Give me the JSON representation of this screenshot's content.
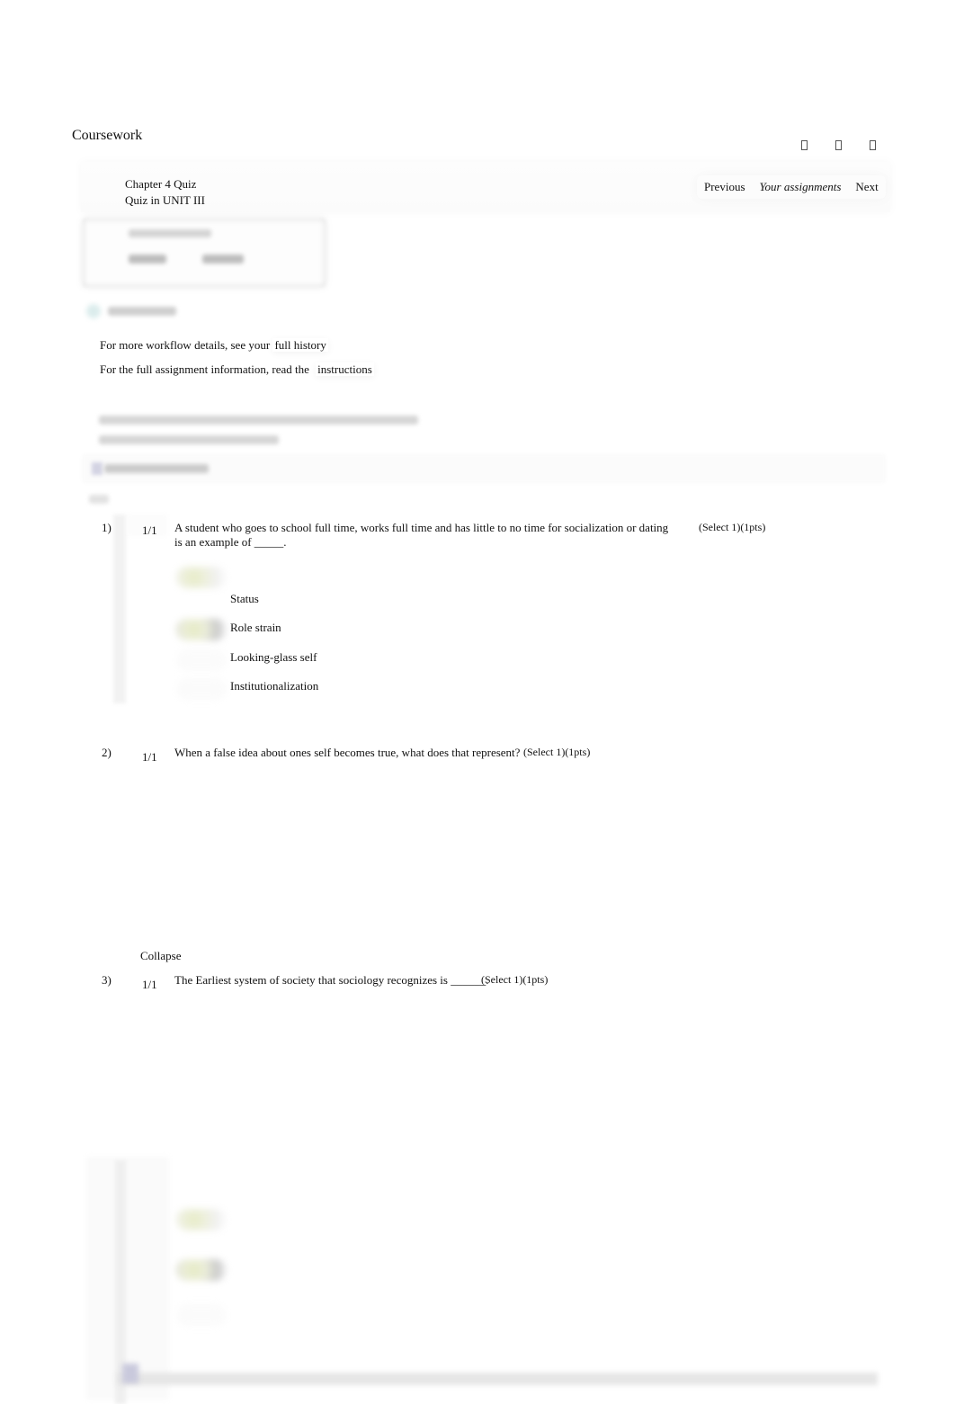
{
  "app": {
    "title": "Coursework",
    "header_icons": [
      "missing-glyph-icon",
      "missing-glyph-icon",
      "missing-glyph-icon"
    ]
  },
  "assignment": {
    "title": "Chapter 4 Quiz",
    "subtitle": "Quiz in UNIT III"
  },
  "nav": {
    "previous": "Previous",
    "your_assignments": "Your assignments",
    "next": "Next"
  },
  "info": {
    "history_prefix": "For more workflow details, see your",
    "history_link": "full history",
    "instructions_prefix": "For the full assignment information, read the",
    "instructions_link": "instructions"
  },
  "questions": [
    {
      "number": "1)",
      "score": "1/1",
      "text": "A student who goes to school full time, works full time and has little to no time for socialization or dating is an example of _____.",
      "meta": "(Select 1)(1pts)",
      "options": [
        {
          "label": "Status",
          "state": "unselected"
        },
        {
          "label": "Role strain",
          "state": "selected"
        },
        {
          "label": "Looking-glass self",
          "state": "unselected"
        },
        {
          "label": "Institutionalization",
          "state": "unselected"
        }
      ]
    },
    {
      "number": "2)",
      "score": "1/1",
      "text": "When a false idea about ones self becomes true, what does that represent?",
      "meta": "(Select 1)(1pts)"
    },
    {
      "number": "3)",
      "score": "1/1",
      "text": "The Earliest system of society that sociology recognizes is ______.",
      "meta": "(Select 1)(1pts)"
    }
  ],
  "collapse_label": "Collapse"
}
